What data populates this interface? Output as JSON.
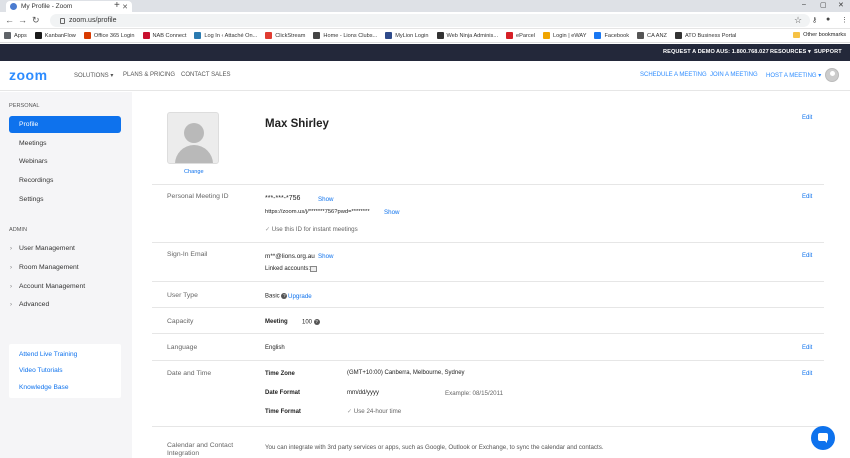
{
  "browser": {
    "tab_title": "My Profile - Zoom",
    "url": "zoom.us/profile",
    "bookmarks": [
      {
        "label": "Apps",
        "color": "#5f6368"
      },
      {
        "label": "KanbanFlow",
        "color": "#1a1a1a"
      },
      {
        "label": "Office 365 Login",
        "color": "#d83b01"
      },
      {
        "label": "NAB Connect",
        "color": "#c8102e"
      },
      {
        "label": "Log In ‹ Attaché On...",
        "color": "#2a7ab0"
      },
      {
        "label": "ClickStream",
        "color": "#e03c31"
      },
      {
        "label": "Home - Lions Clubs...",
        "color": "#444444"
      },
      {
        "label": "MyLion Login",
        "color": "#2e4a8a"
      },
      {
        "label": "Web Ninja Adminis...",
        "color": "#333333"
      },
      {
        "label": "eParcel",
        "color": "#d61f26"
      },
      {
        "label": "Login | eWAY",
        "color": "#f0a500"
      },
      {
        "label": "Facebook",
        "color": "#1877f2"
      },
      {
        "label": "CA ANZ",
        "color": "#555555"
      },
      {
        "label": "ATO Business Portal",
        "color": "#333333"
      }
    ],
    "other_bookmarks": "Other bookmarks"
  },
  "topbar": {
    "request_demo": "REQUEST A DEMO",
    "phone": "AUS: 1.800.768.027",
    "resources": "RESOURCES ▾",
    "support": "SUPPORT"
  },
  "header": {
    "logo": "zoom",
    "solutions": "SOLUTIONS ▾",
    "plans": "PLANS & PRICING",
    "contact_sales": "CONTACT SALES",
    "schedule": "SCHEDULE A MEETING",
    "join": "JOIN A MEETING",
    "host": "HOST A MEETING ▾"
  },
  "sidebar": {
    "personal_heading": "PERSONAL",
    "personal_items": [
      "Profile",
      "Meetings",
      "Webinars",
      "Recordings",
      "Settings"
    ],
    "admin_heading": "ADMIN",
    "admin_items": [
      "User Management",
      "Room Management",
      "Account Management",
      "Advanced"
    ],
    "links": [
      "Attend Live Training",
      "Video Tutorials",
      "Knowledge Base"
    ]
  },
  "profile": {
    "name": "Max Shirley",
    "change": "Change",
    "edit": "Edit",
    "pmi_label": "Personal Meeting ID",
    "pmi_value": "***-***-*756",
    "show": "Show",
    "pmi_url": "https://zoom.us/j/*******756?pwd=********",
    "pmi_instant": "Use this ID for instant meetings",
    "email_label": "Sign-In Email",
    "email_value": "m**@lions.org.au",
    "linked_accounts": "Linked accounts:",
    "user_type_label": "User Type",
    "user_type_value": "Basic",
    "upgrade": "Upgrade",
    "capacity_label": "Capacity",
    "capacity_meeting": "Meeting",
    "capacity_value": "100",
    "language_label": "Language",
    "language_value": "English",
    "datetime_label": "Date and Time",
    "time_zone_label": "Time Zone",
    "time_zone_value": "(GMT+10:00) Canberra, Melbourne, Sydney",
    "date_format_label": "Date Format",
    "date_format_value": "mm/dd/yyyy",
    "date_example": "Example: 08/15/2011",
    "time_format_label": "Time Format",
    "time_format_value": "Use 24-hour time",
    "calendar_label": "Calendar and Contact Integration",
    "calendar_text": "You can integrate with 3rd party services or apps, such as Google, Outlook or Exchange, to sync the calendar and contacts."
  },
  "colors": {
    "zoom_blue": "#2d8cff",
    "active_blue": "#0e72ed",
    "topbar_dark": "#23283a"
  }
}
